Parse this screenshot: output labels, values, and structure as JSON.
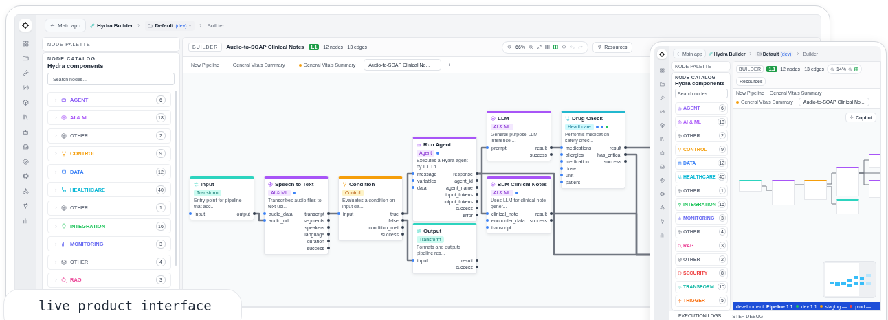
{
  "main": {
    "back_button": "Main app",
    "breadcrumbs": [
      {
        "label": "Hydra Builder",
        "kind": "app"
      },
      {
        "label": "Default",
        "kind": "workspace",
        "badge": "(dev)"
      },
      {
        "label": "Builder",
        "kind": "page"
      }
    ],
    "palette": {
      "header": "NODE PALETTE",
      "eyebrow": "NODE CATALOG",
      "title": "Hydra components",
      "search": {
        "placeholder": "Search nodes..."
      },
      "categories": [
        {
          "label": "AGENT",
          "count": "6",
          "kind": "agent",
          "color": "#8b5cf6"
        },
        {
          "label": "AI & ML",
          "count": "18",
          "kind": "ai",
          "color": "#a855f7"
        },
        {
          "label": "OTHER",
          "count": "2",
          "kind": "other",
          "color": "#6b7280"
        },
        {
          "label": "CONTROL",
          "count": "9",
          "kind": "control",
          "color": "#f59e0b"
        },
        {
          "label": "DATA",
          "count": "12",
          "kind": "data",
          "color": "#3b82f6"
        },
        {
          "label": "HEALTHCARE",
          "count": "40",
          "kind": "healthcare",
          "color": "#06b6d4"
        },
        {
          "label": "OTHER",
          "count": "1",
          "kind": "other",
          "color": "#6b7280"
        },
        {
          "label": "INTEGRATION",
          "count": "16",
          "kind": "integration",
          "color": "#22c55e"
        },
        {
          "label": "MONITORING",
          "count": "3",
          "kind": "monitoring",
          "color": "#6366f1"
        },
        {
          "label": "OTHER",
          "count": "4",
          "kind": "other",
          "color": "#6b7280"
        },
        {
          "label": "RAG",
          "count": "3",
          "kind": "rag",
          "color": "#ec4899"
        }
      ]
    },
    "builder": {
      "badge": "BUILDER",
      "title": "Audio-to-SOAP Clinical Notes",
      "version": "1.1",
      "stats": "12 nodes · 13 edges",
      "zoom": "66%",
      "resources": "Resources",
      "tabs": [
        {
          "label": "New Pipeline",
          "selected": false,
          "modified": false
        },
        {
          "label": "General Vitals Summary",
          "selected": false,
          "modified": false
        },
        {
          "label": "General Vitals Summary",
          "selected": false,
          "modified": true
        },
        {
          "label": "Audio-to-SOAP Clinical No...",
          "selected": true,
          "modified": false
        }
      ],
      "add_tab": "+",
      "nodes": [
        {
          "title": "Input",
          "kind": "transform",
          "tag": "Transform",
          "description": "Entry point for pipeline that acc...",
          "inputs": [
            "input"
          ],
          "outputs": [
            "output"
          ]
        },
        {
          "title": "Speech to Text",
          "kind": "ai",
          "tag": "AI & ML",
          "description": "Transcribes audio files to text usi...",
          "indicators": [
            {
              "color": "#3b82f6"
            }
          ],
          "inputs": [
            "audio_data",
            "audio_url"
          ],
          "outputs": [
            "transcript",
            "segments",
            "speakers",
            "language",
            "duration",
            "success"
          ]
        },
        {
          "title": "Condition",
          "kind": "control",
          "tag": "Control",
          "description": "Evaluates a condition on input da...",
          "inputs": [
            "input"
          ],
          "outputs": [
            "true",
            "false",
            "condition_met",
            "success"
          ]
        },
        {
          "title": "Run Agent",
          "kind": "agent",
          "tag": "Agent",
          "description": "Executes a Hydra agent by ID. Th...",
          "indicators": [
            {
              "color": "#3b82f6"
            }
          ],
          "inputs": [
            "message",
            "variables",
            "data"
          ],
          "outputs": [
            "response",
            "agent_id",
            "agent_name",
            "input_tokens",
            "output_tokens",
            "success",
            "error"
          ]
        },
        {
          "title": "Output",
          "kind": "transform",
          "tag": "Transform",
          "description": "Formats and outputs pipeline res...",
          "inputs": [
            "input"
          ],
          "outputs": [
            "result",
            "success"
          ]
        },
        {
          "title": "LLM",
          "kind": "ai",
          "tag": "AI & ML",
          "description": "General-purpose LLM inference ...",
          "inputs": [
            "prompt"
          ],
          "outputs": [
            "result",
            "success"
          ]
        },
        {
          "title": "BLM Clinical Notes",
          "kind": "ai",
          "tag": "AI & ML",
          "description": "Uses LLM for clinical note gener...",
          "indicators": [
            {
              "color": "#3b82f6"
            }
          ],
          "inputs": [
            "clinical_note",
            "encounter_data",
            "transcript"
          ],
          "outputs": [
            "result",
            "success"
          ]
        },
        {
          "title": "Drug Check",
          "kind": "healthcare",
          "tag": "Healthcare",
          "description": "Performs medication safety chec...",
          "indicators": [
            {
              "color": "#3b82f6"
            },
            {
              "color": "#3b82f6"
            },
            {
              "color": "#22c55e"
            }
          ],
          "inputs": [
            "medications",
            "allergies",
            "medication",
            "dose",
            "unit",
            "patient"
          ],
          "outputs": [
            "result",
            "has_critical",
            "success"
          ]
        }
      ]
    }
  },
  "tablet": {
    "back_button": "Main app",
    "breadcrumbs": [
      {
        "label": "Hydra Builder",
        "kind": "app"
      },
      {
        "label": "Default",
        "kind": "workspace",
        "badge": "(dev)"
      },
      {
        "label": "Builder",
        "kind": "page"
      }
    ],
    "palette": {
      "header": "NODE PALETTE",
      "eyebrow": "NODE CATALOG",
      "title": "Hydra components",
      "search": {
        "placeholder": "Search nodes..."
      },
      "categories": [
        {
          "label": "AGENT",
          "count": "6",
          "kind": "agent",
          "color": "#8b5cf6"
        },
        {
          "label": "AI & ML",
          "count": "18",
          "kind": "ai",
          "color": "#a855f7"
        },
        {
          "label": "OTHER",
          "count": "2",
          "kind": "other",
          "color": "#6b7280"
        },
        {
          "label": "CONTROL",
          "count": "9",
          "kind": "control",
          "color": "#f59e0b"
        },
        {
          "label": "DATA",
          "count": "12",
          "kind": "data",
          "color": "#3b82f6"
        },
        {
          "label": "HEALTHCARE",
          "count": "40",
          "kind": "healthcare",
          "color": "#06b6d4"
        },
        {
          "label": "OTHER",
          "count": "1",
          "kind": "other",
          "color": "#6b7280"
        },
        {
          "label": "INTEGRATION",
          "count": "16",
          "kind": "integration",
          "color": "#22c55e"
        },
        {
          "label": "MONITORING",
          "count": "3",
          "kind": "monitoring",
          "color": "#6366f1"
        },
        {
          "label": "OTHER",
          "count": "4",
          "kind": "other",
          "color": "#6b7280"
        },
        {
          "label": "RAG",
          "count": "3",
          "kind": "rag",
          "color": "#ec4899"
        },
        {
          "label": "OTHER",
          "count": "2",
          "kind": "other",
          "color": "#6b7280"
        },
        {
          "label": "SECURITY",
          "count": "8",
          "kind": "security",
          "color": "#ef4444"
        },
        {
          "label": "TRANSFORM",
          "count": "10",
          "kind": "transform",
          "color": "#14b8a6"
        },
        {
          "label": "TRIGGER",
          "count": "5",
          "kind": "trigger",
          "color": "#f97316"
        }
      ]
    },
    "builder": {
      "badge": "BUILDER",
      "version": "1.1",
      "stats": "12 nodes · 13 edges",
      "zoom": "14%",
      "resources": "Resources",
      "tabs": [
        {
          "label": "New Pipeline",
          "selected": false,
          "modified": false
        },
        {
          "label": "General Vitals Summary",
          "selected": false,
          "modified": false
        },
        {
          "label": "General Vitals Summary",
          "selected": false,
          "modified": true
        },
        {
          "label": "Audio-to-SOAP Clinical No...",
          "selected": true,
          "modified": false
        }
      ],
      "copilot": "Copilot",
      "status_bar": {
        "environment": "development",
        "pipeline": "Pipeline 1.1",
        "stages": [
          {
            "label": "dev 1.1",
            "color": "#22c55e"
          },
          {
            "label": "staging —",
            "color": "#f59e0b"
          },
          {
            "label": "prod —",
            "color": "#ef4444"
          }
        ]
      },
      "bottom_tabs": [
        {
          "label": "EXECUTION LOGS",
          "selected": true
        },
        {
          "label": "STEP DEBUG",
          "selected": false
        }
      ]
    }
  },
  "caption": "live product interface"
}
